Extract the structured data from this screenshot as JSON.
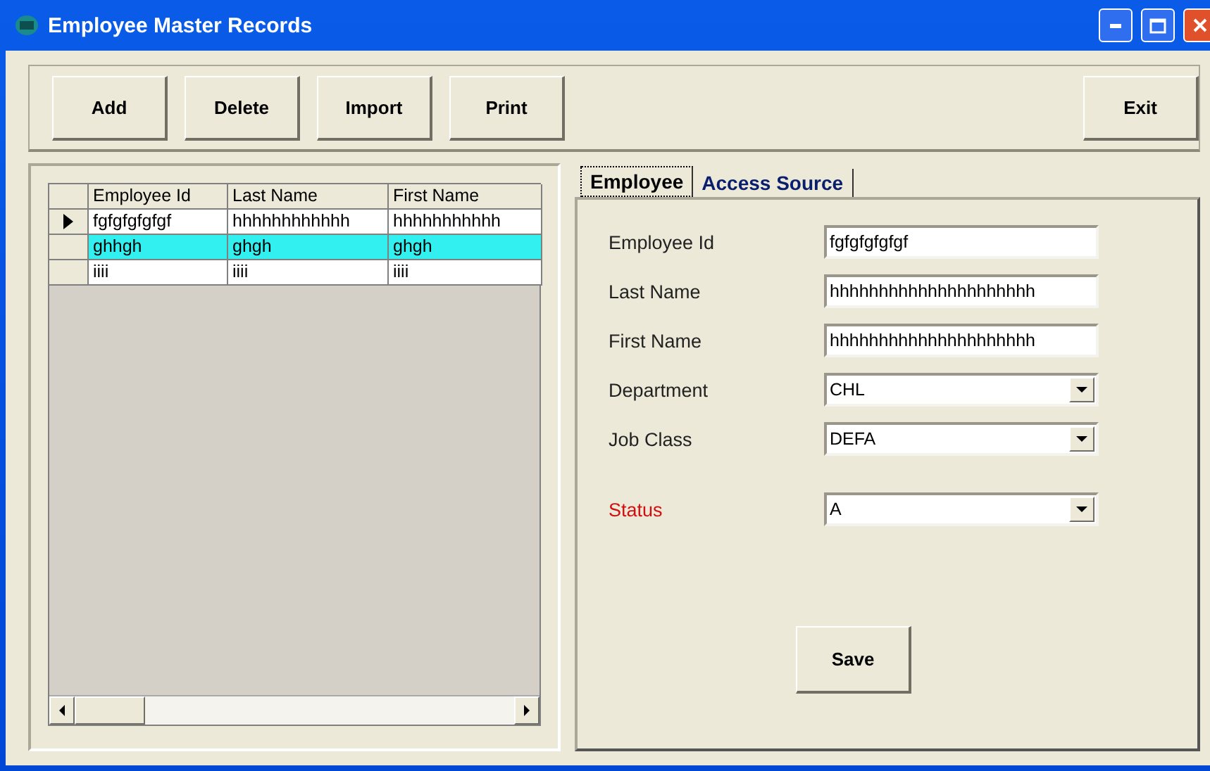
{
  "window": {
    "title": "Employee Master Records"
  },
  "toolbar": {
    "left_buttons": [
      "Add",
      "Delete",
      "Import",
      "Print"
    ],
    "right_buttons": [
      "Exit"
    ]
  },
  "grid": {
    "columns": [
      "Employee Id",
      "Last Name",
      "First Name"
    ],
    "rows": [
      {
        "cells": [
          "fgfgfgfgfgf",
          "hhhhhhhhhhhh",
          "hhhhhhhhhhh"
        ],
        "current": true,
        "selected": false
      },
      {
        "cells": [
          "ghhgh",
          "ghgh",
          "ghgh"
        ],
        "current": false,
        "selected": true
      },
      {
        "cells": [
          "iiii",
          "iiii",
          "iiii"
        ],
        "current": false,
        "selected": false
      }
    ]
  },
  "tabs": [
    {
      "label": "Employee",
      "selected": true
    },
    {
      "label": "Access Source",
      "selected": false
    }
  ],
  "form": {
    "fields": [
      {
        "label": "Employee Id",
        "value": "fgfgfgfgfgf",
        "kind": "text",
        "required": false
      },
      {
        "label": "Last Name",
        "value": "hhhhhhhhhhhhhhhhhhhhh",
        "kind": "text",
        "required": false
      },
      {
        "label": "First Name",
        "value": "hhhhhhhhhhhhhhhhhhhhh",
        "kind": "text",
        "required": false
      },
      {
        "label": "Department",
        "value": "CHL",
        "kind": "dropdown",
        "required": false
      },
      {
        "label": "Job Class",
        "value": "DEFA",
        "kind": "dropdown",
        "required": false
      },
      {
        "label": "Status",
        "value": "A",
        "kind": "dropdown",
        "required": true
      }
    ],
    "save_button": "Save"
  }
}
